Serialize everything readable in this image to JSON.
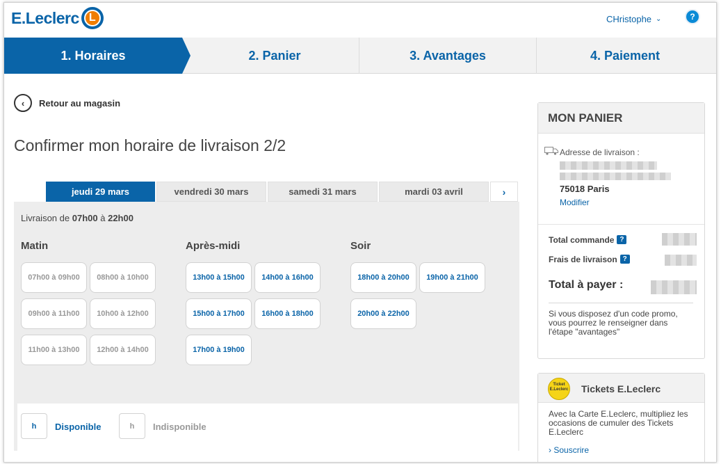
{
  "header": {
    "logo_text": "E.Leclerc",
    "logo_letter": "L",
    "user_name": "CHristophe",
    "help_label": "?"
  },
  "steps": [
    {
      "label": "1. Horaires"
    },
    {
      "label": "2. Panier"
    },
    {
      "label": "3. Avantages"
    },
    {
      "label": "4. Paiement"
    }
  ],
  "back_label": "Retour au magasin",
  "page_title": "Confirmer mon horaire de livraison 2/2",
  "days": [
    {
      "label": "jeudi 29 mars"
    },
    {
      "label": "vendredi 30 mars"
    },
    {
      "label": "samedi 31 mars"
    },
    {
      "label": "mardi 03 avril"
    }
  ],
  "delivery": {
    "prefix": "Livraison de",
    "from": "07h00",
    "sep": "à",
    "to": "22h00"
  },
  "columns": {
    "morning": "Matin",
    "afternoon": "Après-midi",
    "evening": "Soir"
  },
  "slots": {
    "morning": [
      {
        "label": "07h00 à 09h00",
        "available": false
      },
      {
        "label": "08h00 à 10h00",
        "available": false
      },
      {
        "label": "09h00 à 11h00",
        "available": false
      },
      {
        "label": "10h00 à 12h00",
        "available": false
      },
      {
        "label": "11h00 à 13h00",
        "available": false
      },
      {
        "label": "12h00 à 14h00",
        "available": false
      }
    ],
    "afternoon": [
      {
        "label": "13h00 à 15h00",
        "available": true
      },
      {
        "label": "14h00 à 16h00",
        "available": true
      },
      {
        "label": "15h00 à 17h00",
        "available": true
      },
      {
        "label": "16h00 à 18h00",
        "available": true
      },
      {
        "label": "17h00 à 19h00",
        "available": true
      }
    ],
    "evening": [
      {
        "label": "18h00 à 20h00",
        "available": true
      },
      {
        "label": "19h00 à 21h00",
        "available": true
      },
      {
        "label": "20h00 à 22h00",
        "available": true
      }
    ]
  },
  "legend": {
    "box_letter": "h",
    "available_label": "Disponible",
    "unavailable_label": "Indisponible"
  },
  "cart": {
    "title": "MON PANIER",
    "address_label": "Adresse de livraison :",
    "city": "75018 Paris",
    "modify": "Modifier",
    "total_order_label": "Total commande",
    "shipping_label": "Frais de livraison",
    "total_pay_label": "Total à payer :",
    "promo_text": "Si vous disposez d'un code promo, vous pourrez le renseigner dans l'étape \"avantages\""
  },
  "tickets": {
    "title": "Tickets E.Leclerc",
    "icon_text": "Ticket E.Leclerc",
    "text": "Avec la Carte E.Leclerc, multipliez les occasions de cumuler des Tickets E.Leclerc",
    "link": "Souscrire"
  },
  "colors": {
    "brand_blue": "#0a64a8",
    "brand_orange": "#f07d00"
  }
}
